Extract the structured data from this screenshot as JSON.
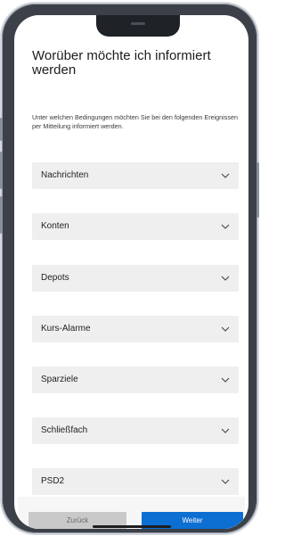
{
  "page": {
    "title": "Worüber möchte ich informiert werden",
    "subtitle": "Unter welchen Bedingungen möchten Sie bei den folgenden Ereignissen per Mitteilung informiert werden."
  },
  "categories": [
    {
      "label": "Nachrichten",
      "icon": "chevron-down-icon"
    },
    {
      "label": "Konten",
      "icon": "chevron-down-icon"
    },
    {
      "label": "Depots",
      "icon": "chevron-down-icon"
    },
    {
      "label": "Kurs-Alarme",
      "icon": "chevron-down-icon"
    },
    {
      "label": "Sparziele",
      "icon": "chevron-down-icon"
    },
    {
      "label": "Schließfach",
      "icon": "chevron-down-icon"
    },
    {
      "label": "PSD2",
      "icon": "chevron-down-icon"
    }
  ],
  "footer": {
    "back_label": "Zurück",
    "next_label": "Weiter"
  },
  "colors": {
    "accent": "#0c6fd1",
    "item_background": "#efefef",
    "back_button": "#c9c9c9"
  }
}
